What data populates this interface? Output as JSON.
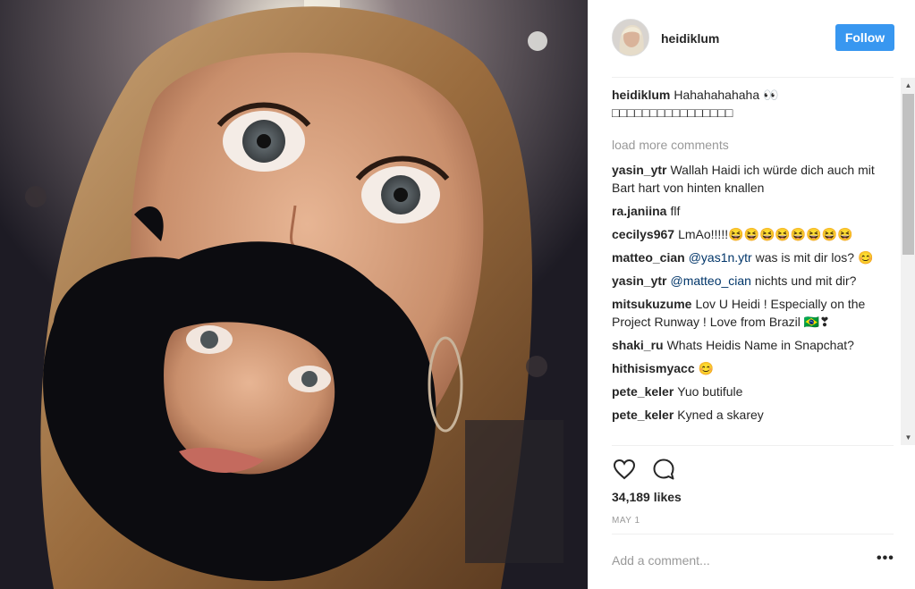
{
  "post": {
    "username": "heidiklum",
    "follow_label": "Follow",
    "caption_user": "heidiklum",
    "caption_text": "Hahahahahaha 👀□□□□□□□□□□□□□□□□",
    "load_more": "load more comments",
    "comments": [
      {
        "user": "yasin_ytr",
        "text": "Wallah Haidi ich würde dich auch mit Bart hart von hinten knallen"
      },
      {
        "user": "ra.janiina",
        "text": "flf"
      },
      {
        "user": "cecilys967",
        "text": "LmAo!!!!!😆😆😆😆😆😆😆😆"
      },
      {
        "user": "matteo_cian",
        "mention": "@yas1n.ytr",
        "text": " was is mit dir los? 😊"
      },
      {
        "user": "yasin_ytr",
        "mention": "@matteo_cian",
        "text": " nichts und mit dir?"
      },
      {
        "user": "mitsukuzume",
        "text": "Lov U Heidi ! Especially on the Project Runway ! Love from Brazil 🇧🇷❣"
      },
      {
        "user": "shaki_ru",
        "text": "Whats Heidis Name in Snapchat?"
      },
      {
        "user": "hithisismyacc",
        "text": "😊"
      },
      {
        "user": "pete_keler",
        "text": "Yuo butifule"
      },
      {
        "user": "pete_keler",
        "text": "Kyned a skarey"
      }
    ],
    "likes": "34,189 likes",
    "date": "MAY 1",
    "add_comment_placeholder": "Add a comment...",
    "more_options": "•••"
  },
  "icons": {
    "like": "heart-icon",
    "comment": "comment-bubble-icon",
    "scroll_up": "scroll-up-arrow",
    "scroll_down": "scroll-down-arrow"
  },
  "colors": {
    "follow_button": "#3897f0",
    "text": "#262626",
    "muted": "#999999",
    "mention": "#003569"
  }
}
